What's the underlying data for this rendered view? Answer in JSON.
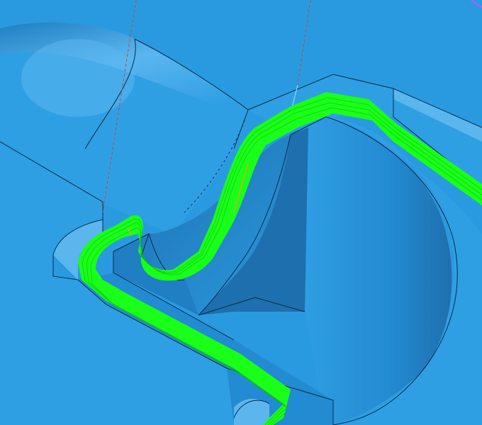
{
  "viewport": {
    "background": "#2a9ae0"
  },
  "colors": {
    "part_face_light": "#5bb6ee",
    "part_face": "#2f9fe4",
    "part_face_dark": "#1f7fc2",
    "pocket_wall_shadow": "#1e6fae",
    "edge_line": "#0b2a45",
    "toolpath": "#19ff19",
    "toolpath_dark": "#0fbf0f",
    "toolpath_highlight": "#ff9a1a",
    "projection_line": "#d0402a",
    "tool_axis": "#7fd7ff",
    "accent_edge": "#b15cff"
  },
  "icons": {
    "toolpath": "toolpath-icon",
    "tool_axis": "tool-axis-icon"
  }
}
